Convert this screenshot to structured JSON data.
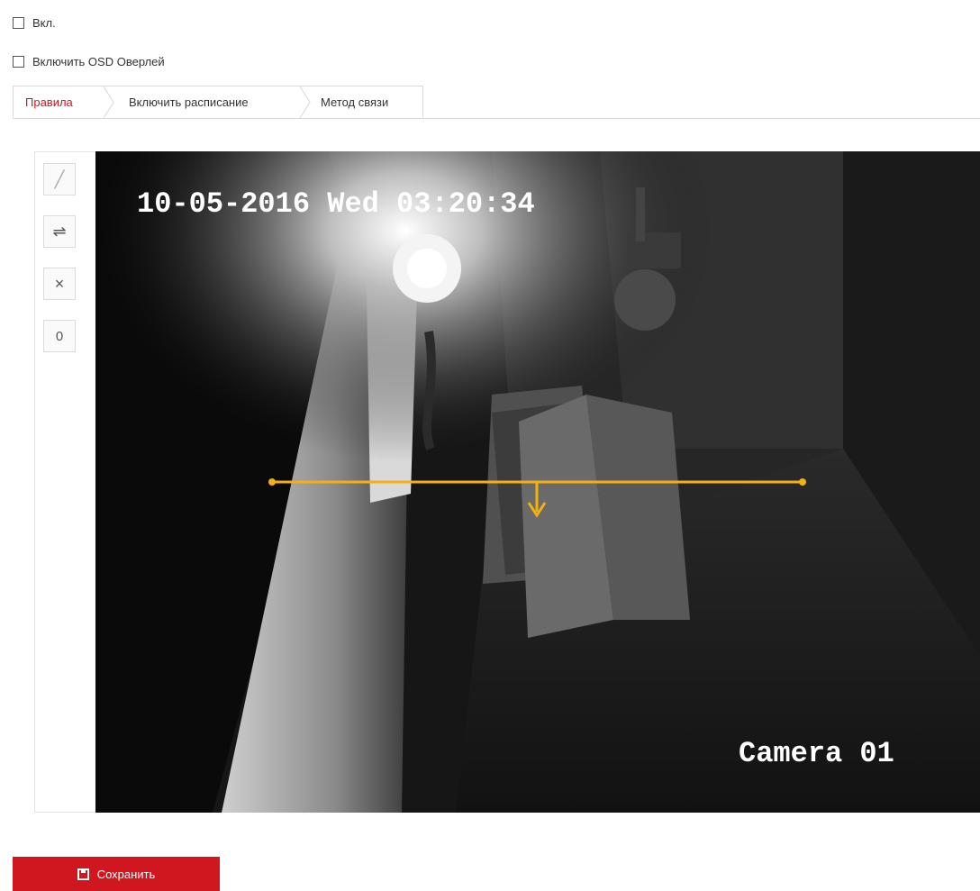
{
  "options": {
    "enable_label": "Вкл.",
    "osd_overlay_label": "Включить OSD Оверлей"
  },
  "tabs": [
    {
      "label": "Правила",
      "active": true
    },
    {
      "label": "Включить расписание",
      "active": false
    },
    {
      "label": "Метод связи",
      "active": false
    }
  ],
  "toolbar": {
    "tools": [
      {
        "icon": "draw-line-icon",
        "glyph": "╱"
      },
      {
        "icon": "swap-direction-icon",
        "glyph": "⇌"
      },
      {
        "icon": "delete-icon",
        "glyph": "×"
      },
      {
        "icon": "clear-icon",
        "glyph": "0"
      }
    ]
  },
  "video": {
    "osd_timestamp": "10-05-2016 Wed 03:20:34",
    "camera_name": "Camera 01",
    "line_color": "#f2b10f"
  },
  "actions": {
    "save_label": "Сохранить"
  },
  "colors": {
    "accent": "#d0161e",
    "active_tab": "#c6181f"
  }
}
